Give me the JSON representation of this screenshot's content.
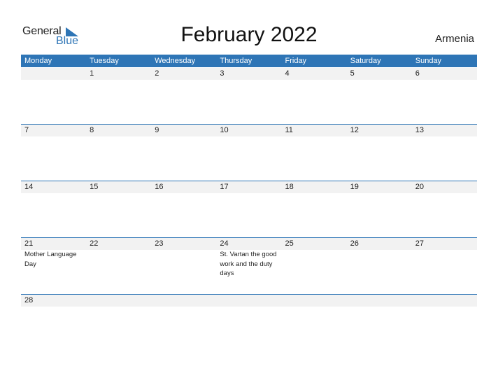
{
  "logo": {
    "general": "General",
    "blue": "Blue"
  },
  "title": "February 2022",
  "country": "Armenia",
  "colors": {
    "accent": "#2e75b6",
    "row_bg": "#f2f2f2"
  },
  "weekdays": [
    "Monday",
    "Tuesday",
    "Wednesday",
    "Thursday",
    "Friday",
    "Saturday",
    "Sunday"
  ],
  "weeks": [
    {
      "days": [
        "",
        "1",
        "2",
        "3",
        "4",
        "5",
        "6"
      ],
      "events": [
        "",
        "",
        "",
        "",
        "",
        "",
        ""
      ]
    },
    {
      "days": [
        "7",
        "8",
        "9",
        "10",
        "11",
        "12",
        "13"
      ],
      "events": [
        "",
        "",
        "",
        "",
        "",
        "",
        ""
      ]
    },
    {
      "days": [
        "14",
        "15",
        "16",
        "17",
        "18",
        "19",
        "20"
      ],
      "events": [
        "",
        "",
        "",
        "",
        "",
        "",
        ""
      ]
    },
    {
      "days": [
        "21",
        "22",
        "23",
        "24",
        "25",
        "26",
        "27"
      ],
      "events": [
        "Mother Language Day",
        "",
        "",
        "St. Vartan the good work and the duty days",
        "",
        "",
        ""
      ]
    },
    {
      "days": [
        "28",
        "",
        "",
        "",
        "",
        "",
        ""
      ],
      "events": [
        "",
        "",
        "",
        "",
        "",
        "",
        ""
      ]
    }
  ]
}
